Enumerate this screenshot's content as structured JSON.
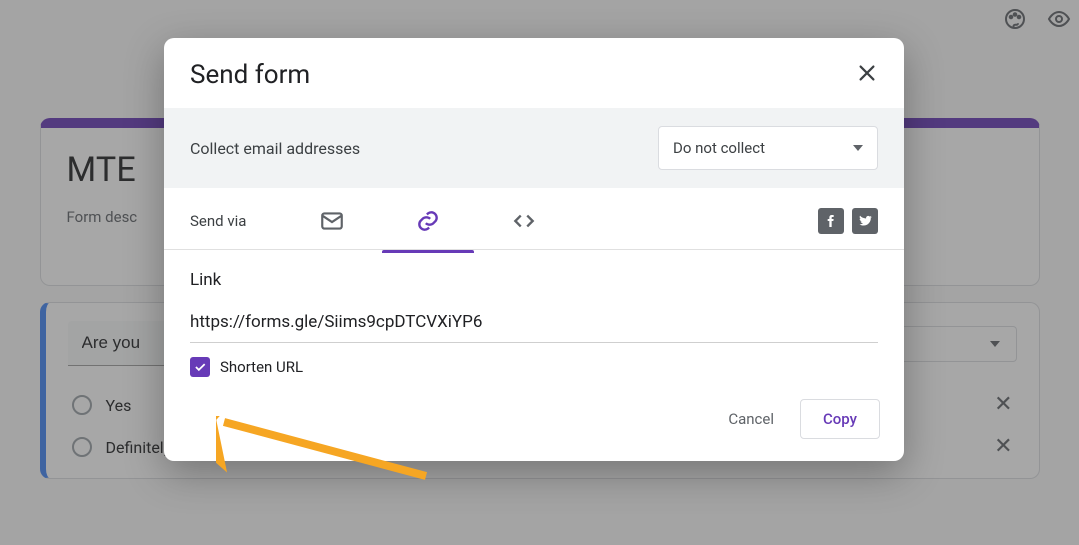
{
  "background": {
    "form_title": "MTE",
    "form_description": "Form desc",
    "question_text": "Are you",
    "options": [
      "Yes",
      "Definitely Yes"
    ]
  },
  "dialog": {
    "title": "Send form",
    "collect_label": "Collect email addresses",
    "collect_selected": "Do not collect",
    "send_via_label": "Send via",
    "tabs": {
      "email": "email-tab",
      "link": "link-tab",
      "embed": "embed-tab",
      "active": "link"
    },
    "link_heading": "Link",
    "link_value": "https://forms.gle/Siims9cpDTCVXiYP6",
    "shorten_label": "Shorten URL",
    "shorten_checked": true,
    "cancel_label": "Cancel",
    "copy_label": "Copy"
  },
  "colors": {
    "accent": "#673ab7"
  }
}
